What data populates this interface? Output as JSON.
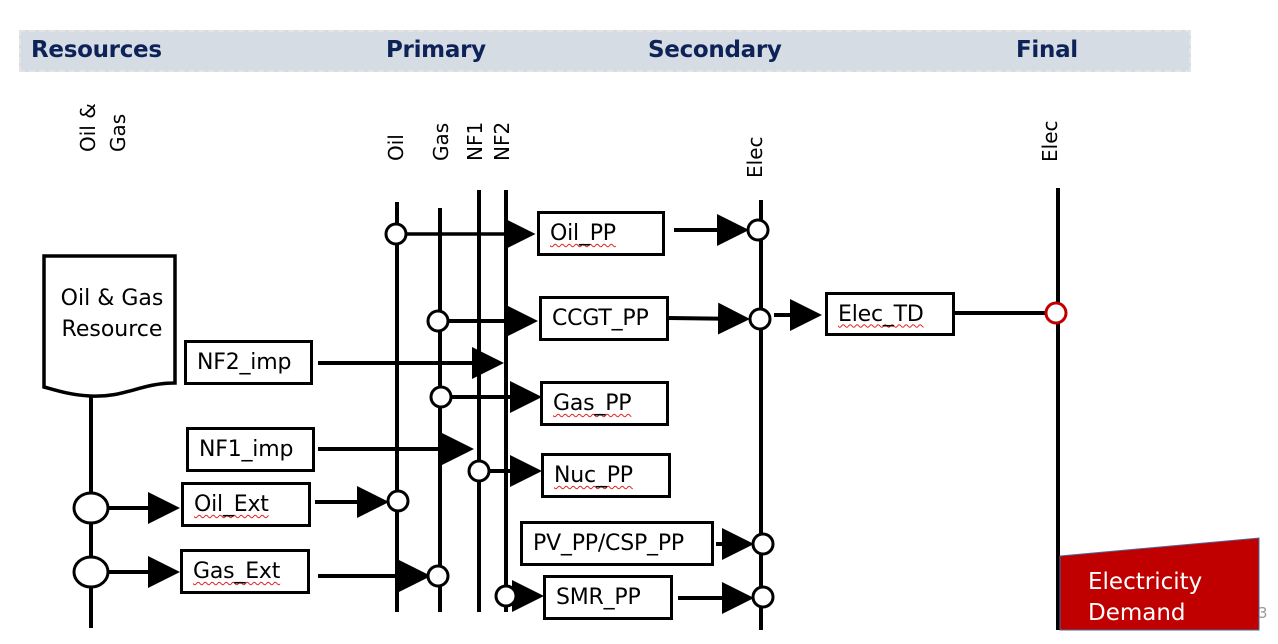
{
  "header": {
    "stages": [
      "Resources",
      "Primary",
      "Secondary",
      "Final"
    ]
  },
  "carriers": {
    "resource": [
      "Oil &",
      "Gas"
    ],
    "oil": "Oil",
    "gas": "Gas",
    "nf1": "NF1",
    "nf2": "NF2",
    "elec_secondary": "Elec",
    "elec_final": "Elec"
  },
  "resource_node": {
    "line1": "Oil & Gas",
    "line2": "Resource"
  },
  "technologies": {
    "nf2_imp": "NF2_imp",
    "nf1_imp": "NF1_imp",
    "oil_ext": "Oil_Ext",
    "gas_ext": "Gas_Ext",
    "oil_pp": "Oil_PP",
    "ccgt_pp": "CCGT_PP",
    "gas_pp": "Gas_PP",
    "nuc_pp": "Nuc_PP",
    "pv_csp_pp": "PV_PP/CSP_PP",
    "smr_pp": "SMR_PP",
    "elec_td": "Elec_TD"
  },
  "demand": {
    "line1": "Electricity",
    "line2": "Demand",
    "color": "#c00000"
  },
  "colors": {
    "header_text": "#0d2257",
    "header_band": "#d6dce4",
    "final_node_ring": "#c00000"
  },
  "page_number": "3"
}
